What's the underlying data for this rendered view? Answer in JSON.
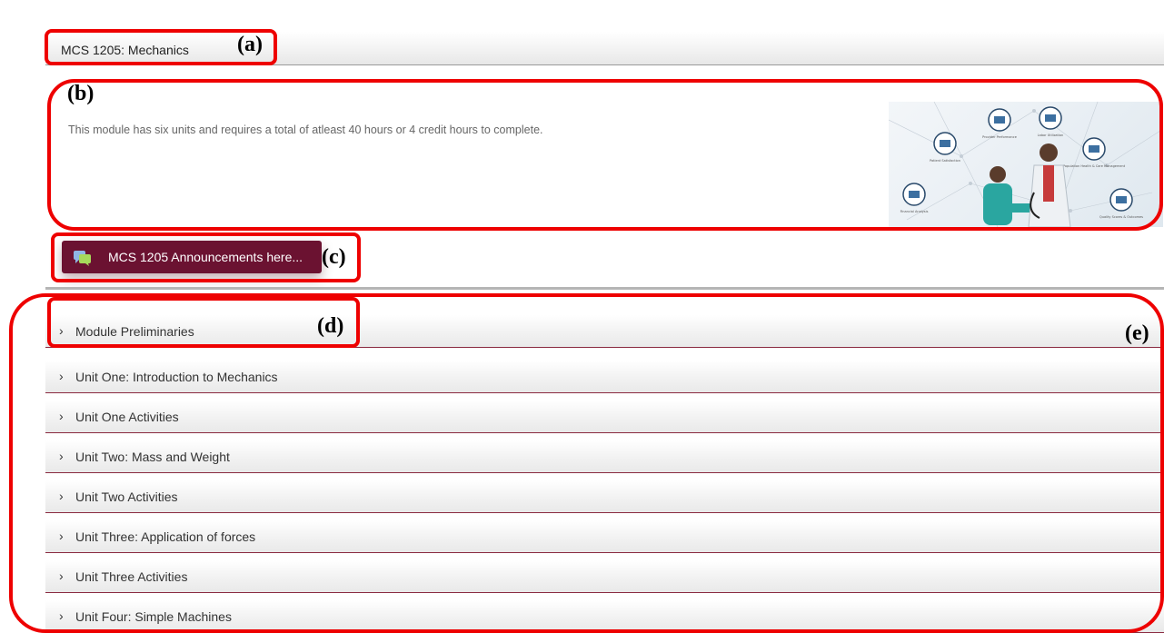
{
  "course": {
    "title": "MCS 1205: Mechanics"
  },
  "summary": {
    "text": "This module has six units and requires a total of atleast 40 hours or 4 credit hours to complete."
  },
  "summary_image": {
    "labels": [
      "Provider Performance",
      "Labor Utilization",
      "Patient Satisfaction",
      "Population Health & Care Management",
      "Financial Analysis",
      "Quality Scores & Outcomes"
    ]
  },
  "announcements": {
    "label": "MCS 1205 Announcements here..."
  },
  "sections": [
    {
      "label": "Module Preliminaries"
    },
    {
      "label": "Unit One: Introduction to Mechanics"
    },
    {
      "label": "Unit One Activities"
    },
    {
      "label": "Unit Two: Mass and Weight"
    },
    {
      "label": "Unit Two Activities"
    },
    {
      "label": "Unit Three: Application of forces"
    },
    {
      "label": "Unit Three Activities"
    },
    {
      "label": "Unit Four: Simple Machines"
    }
  ],
  "annotations": {
    "a": "(a)",
    "b": "(b)",
    "c": "(c)",
    "d": "(d)",
    "e": "(e)"
  },
  "colors": {
    "accent": "#6b1231",
    "annotation": "#ee0000",
    "section_border": "#8a2a40"
  }
}
